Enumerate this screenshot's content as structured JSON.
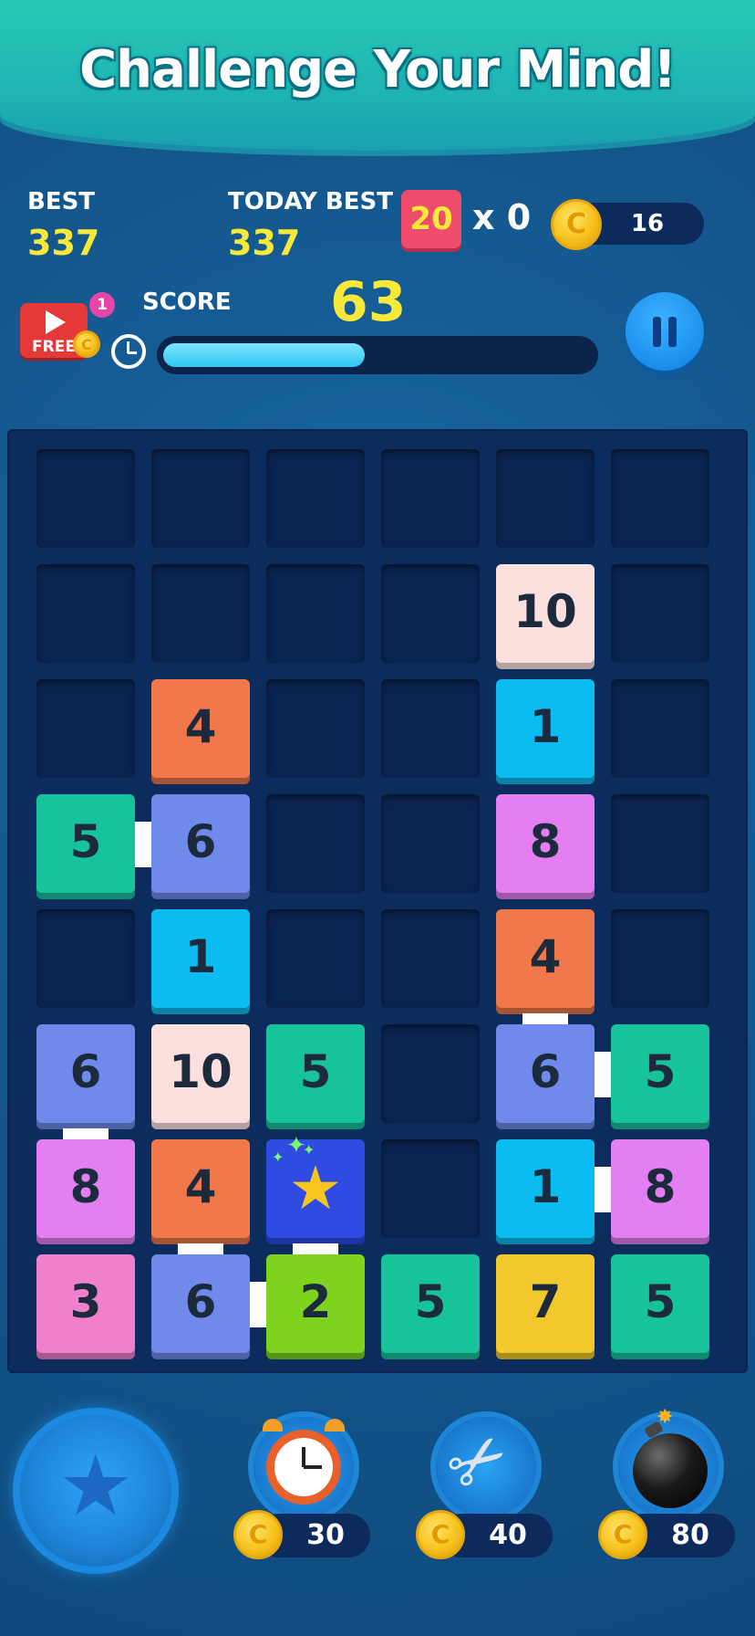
{
  "header": {
    "title": "Challenge Your Mind!"
  },
  "stats": {
    "best_label": "BEST",
    "best_value": "337",
    "today_best_label": "TODAY BEST",
    "today_best_value": "337",
    "multiplier_value": "20",
    "multiplier_text": "x 0",
    "coins": "16",
    "score_label": "SCORE",
    "score_value": "63",
    "timer_progress": 0.47
  },
  "free_ad": {
    "label": "FREE",
    "badge": "1"
  },
  "coin_symbol": "C",
  "board": {
    "rows": [
      [
        "",
        "",
        "",
        "",
        "",
        ""
      ],
      [
        "",
        "",
        "",
        "",
        "10",
        ""
      ],
      [
        "",
        "4",
        "",
        "",
        "1",
        ""
      ],
      [
        "5",
        "6",
        "",
        "",
        "8",
        ""
      ],
      [
        "",
        "1",
        "",
        "",
        "4",
        ""
      ],
      [
        "6",
        "10",
        "5",
        "",
        "6",
        "5"
      ],
      [
        "8",
        "4",
        "star",
        "",
        "1",
        "8"
      ],
      [
        "3",
        "6",
        "2",
        "5",
        "7",
        "5"
      ]
    ]
  },
  "tile_colors": {
    "1": "#0bbcf2",
    "2": "#7ed31e",
    "3": "#f07fcc",
    "4": "#f0784a",
    "5": "#17c39a",
    "6": "#6f8aea",
    "7": "#f2c92d",
    "8": "#e37ff0",
    "10": "#fce0de"
  },
  "powerups": {
    "clock_cost": "30",
    "scissors_cost": "40",
    "bomb_cost": "80"
  },
  "icons": [
    "play-icon",
    "alarm-clock-icon",
    "pause-icon",
    "star-icon",
    "scissors-icon",
    "bomb-icon",
    "coin-icon"
  ]
}
